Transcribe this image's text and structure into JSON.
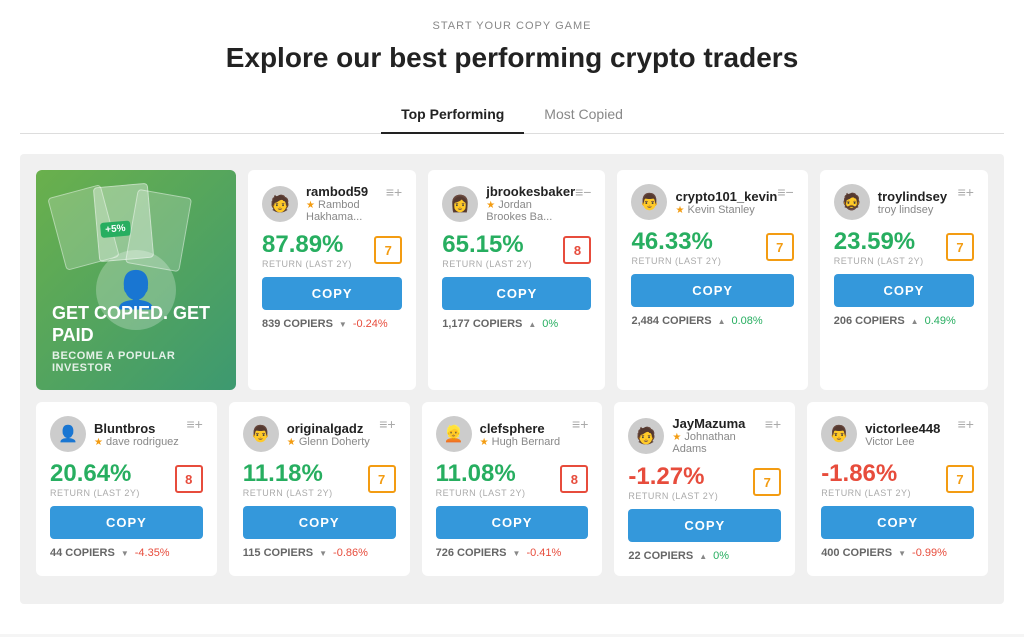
{
  "header": {
    "start_label": "START YOUR COPY GAME",
    "main_title": "Explore our best performing crypto traders"
  },
  "tabs": [
    {
      "id": "top-performing",
      "label": "Top Performing",
      "active": true
    },
    {
      "id": "most-copied",
      "label": "Most Copied",
      "active": false
    }
  ],
  "promo": {
    "title": "GET COPIED. GET PAID",
    "subtitle": "BECOME A POPULAR INVESTOR"
  },
  "traders_row1": [
    {
      "username": "rambod59",
      "fullname": "Rambod Hakhama...",
      "star": true,
      "return_value": "87.89%",
      "return_positive": true,
      "return_label": "RETURN (LAST 2Y)",
      "risk": "7",
      "risk_color": "orange",
      "copy_label": "COPY",
      "copiers": "839 COPIERS",
      "change": "-0.24%",
      "change_positive": false
    },
    {
      "username": "jbrookesbaker",
      "fullname": "Jordan Brookes Ba...",
      "star": true,
      "return_value": "65.15%",
      "return_positive": true,
      "return_label": "RETURN (LAST 2Y)",
      "risk": "8",
      "risk_color": "red",
      "copy_label": "COPY",
      "copiers": "1,177 COPIERS",
      "change": "0%",
      "change_positive": true
    },
    {
      "username": "crypto101_kevin",
      "fullname": "Kevin Stanley",
      "star": true,
      "return_value": "46.33%",
      "return_positive": true,
      "return_label": "RETURN (LAST 2Y)",
      "risk": "7",
      "risk_color": "orange",
      "copy_label": "COPY",
      "copiers": "2,484 COPIERS",
      "change": "0.08%",
      "change_positive": true
    },
    {
      "username": "troylindsey",
      "fullname": "troy lindsey",
      "star": false,
      "return_value": "23.59%",
      "return_positive": true,
      "return_label": "RETURN (LAST 2Y)",
      "risk": "7",
      "risk_color": "orange",
      "copy_label": "COPY",
      "copiers": "206 COPIERS",
      "change": "0.49%",
      "change_positive": true
    }
  ],
  "traders_row2": [
    {
      "username": "Bluntbros",
      "fullname": "dave rodriguez",
      "star": true,
      "return_value": "20.64%",
      "return_positive": true,
      "return_label": "RETURN (LAST 2Y)",
      "risk": "8",
      "risk_color": "red",
      "copy_label": "COPY",
      "copiers": "44 COPIERS",
      "change": "-4.35%",
      "change_positive": false
    },
    {
      "username": "originalgadz",
      "fullname": "Glenn Doherty",
      "star": true,
      "return_value": "11.18%",
      "return_positive": true,
      "return_label": "RETURN (LAST 2Y)",
      "risk": "7",
      "risk_color": "orange",
      "copy_label": "COPY",
      "copiers": "115 COPIERS",
      "change": "-0.86%",
      "change_positive": false
    },
    {
      "username": "clefsphere",
      "fullname": "Hugh Bernard",
      "star": true,
      "return_value": "11.08%",
      "return_positive": true,
      "return_label": "RETURN (LAST 2Y)",
      "risk": "8",
      "risk_color": "red",
      "copy_label": "COPY",
      "copiers": "726 COPIERS",
      "change": "-0.41%",
      "change_positive": false
    },
    {
      "username": "JayMazuma",
      "fullname": "Johnathan Adams",
      "star": true,
      "return_value": "-1.27%",
      "return_positive": false,
      "return_label": "RETURN (LAST 2Y)",
      "risk": "7",
      "risk_color": "orange",
      "copy_label": "COPY",
      "copiers": "22 COPIERS",
      "change": "0%",
      "change_positive": true
    },
    {
      "username": "victorlee448",
      "fullname": "Victor Lee",
      "star": false,
      "return_value": "-1.86%",
      "return_positive": false,
      "return_label": "RETURN (LAST 2Y)",
      "risk": "7",
      "risk_color": "orange",
      "copy_label": "COPY",
      "copiers": "400 COPIERS",
      "change": "-0.99%",
      "change_positive": false
    }
  ]
}
